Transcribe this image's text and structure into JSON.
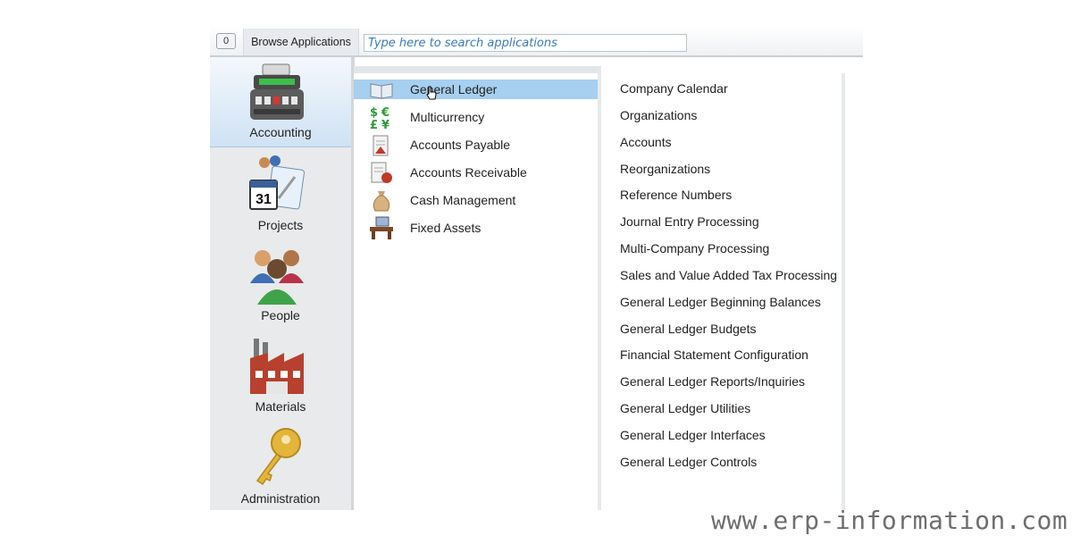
{
  "toolbar": {
    "window_count": "0",
    "browse_label": "Browse Applications",
    "search_placeholder": "Type here to search applications"
  },
  "sidebar": {
    "categories": [
      {
        "label": "Accounting",
        "icon": "cash-register-icon",
        "active": true
      },
      {
        "label": "Projects",
        "icon": "calendar-icon",
        "active": false
      },
      {
        "label": "People",
        "icon": "people-icon",
        "active": false
      },
      {
        "label": "Materials",
        "icon": "factory-icon",
        "active": false
      },
      {
        "label": "Administration",
        "icon": "key-icon",
        "active": false
      }
    ]
  },
  "applications": {
    "items": [
      {
        "label": "General Ledger",
        "icon": "ledger-book-icon",
        "selected": true
      },
      {
        "label": "Multicurrency",
        "icon": "currency-icon",
        "selected": false
      },
      {
        "label": "Accounts Payable",
        "icon": "invoice-icon",
        "selected": false
      },
      {
        "label": "Accounts Receivable",
        "icon": "receivable-icon",
        "selected": false
      },
      {
        "label": "Cash Management",
        "icon": "money-bag-icon",
        "selected": false
      },
      {
        "label": "Fixed Assets",
        "icon": "desk-icon",
        "selected": false
      }
    ]
  },
  "functions": {
    "items": [
      "Company Calendar",
      "Organizations",
      "Accounts",
      "Reorganizations",
      "Reference Numbers",
      "Journal Entry Processing",
      "Multi-Company Processing",
      "Sales and Value Added Tax Processing",
      "General Ledger Beginning Balances",
      "General Ledger Budgets",
      "Financial Statement Configuration",
      "General Ledger Reports/Inquiries",
      "General Ledger Utilities",
      "General Ledger Interfaces",
      "General Ledger Controls"
    ]
  },
  "watermark": "www.erp-information.com",
  "colors": {
    "selection": "#a6cff0",
    "search_text": "#3a7bbf",
    "sidebar_bg": "#e9eaeb"
  }
}
